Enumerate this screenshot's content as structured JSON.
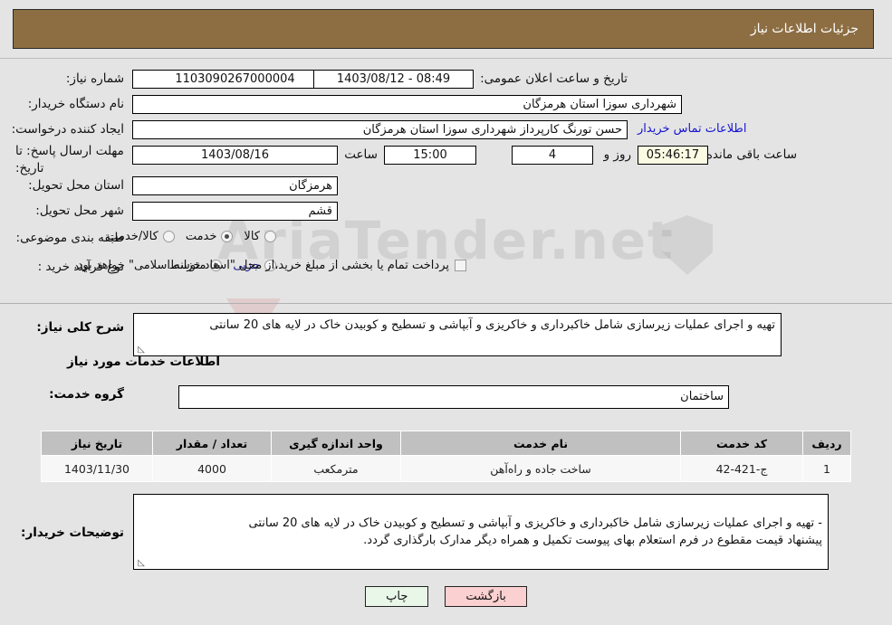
{
  "header": {
    "title": "جزئیات اطلاعات نیاز"
  },
  "form": {
    "need_number_label": "شماره نیاز:",
    "need_number_value": "1103090267000004",
    "announce_label": "تاریخ و ساعت اعلان عمومی:",
    "announce_value": "08:49 - 1403/08/12",
    "buyer_org_label": "نام دستگاه خریدار:",
    "buyer_org_value": "شهرداری سوزا استان هرمزگان",
    "creator_label": "ایجاد کننده درخواست:",
    "creator_value": "حسن تورنگ کارپرداز شهرداری سوزا استان هرمزگان",
    "contact_link": "اطلاعات تماس خریدار",
    "deadline_label": "مهلت ارسال پاسخ: تا تاریخ:",
    "deadline_date": "1403/08/16",
    "time_label": "ساعت",
    "time_value": "15:00",
    "days_value": "4",
    "days_unit": "روز و",
    "countdown_value": "05:46:17",
    "countdown_unit": "ساعت باقی مانده",
    "province_label": "استان محل تحویل:",
    "province_value": "هرمزگان",
    "city_label": "شهر محل تحویل:",
    "city_value": "قشم",
    "category_label": "طبقه بندی موضوعی:",
    "category_options": [
      {
        "label": "کالا",
        "selected": false
      },
      {
        "label": "خدمت",
        "selected": true
      },
      {
        "label": "کالا/خدمت",
        "selected": false
      }
    ],
    "process_label": "نوع فرآیند خرید :",
    "process_options": [
      {
        "label": "جزیی",
        "selected": false
      },
      {
        "label": "متوسط",
        "selected": true
      }
    ],
    "treasury_checkbox_label": "پرداخت تمام یا بخشی از مبلغ خرید،از محل \"اسناد خزانه اسلامی\" خواهد بود.",
    "treasury_checked": false
  },
  "description": {
    "label": "شرح کلی نیاز:",
    "value": "تهیه و اجرای عملیات زیرسازی شامل خاکبرداری و خاکریزی و آبپاشی و تسطیح و کوبیدن خاک در لایه های 20 سانتی"
  },
  "services_section": {
    "heading": "اطلاعات خدمات مورد نیاز",
    "group_label": "گروه خدمت:",
    "group_value": "ساختمان"
  },
  "table": {
    "columns": [
      "ردیف",
      "کد خدمت",
      "نام خدمت",
      "واحد اندازه گیری",
      "تعداد / مقدار",
      "تاریخ نیاز"
    ],
    "rows": [
      {
        "row_no": "1",
        "service_code": "ج-421-42",
        "service_name": "ساخت جاده و راه‌آهن",
        "unit": "مترمکعب",
        "quantity": "4000",
        "need_date": "1403/11/30"
      }
    ]
  },
  "buyer_notes": {
    "label": "توضیحات خریدار:",
    "value": "- تهیه و اجرای عملیات زیرسازی شامل خاکبرداری و خاکریزی و آبپاشی و تسطیح و کوبیدن خاک در لایه های 20 سانتی\nپیشنهاد قیمت مقطوع در فرم استعلام بهای پیوست تکمیل و همراه دیگر مدارک بارگذاری گردد."
  },
  "footer": {
    "print_label": "چاپ",
    "back_label": "بازگشت"
  },
  "watermark": {
    "text": "AriaTender.net"
  },
  "colors": {
    "header_bg": "#8d6e43",
    "link": "#1414d2",
    "countdown_bg": "#fbfbe4",
    "print_btn_bg": "#e9f7e9",
    "back_btn_bg": "#fbd0d0",
    "table_header_bg": "#c0c0c0"
  }
}
